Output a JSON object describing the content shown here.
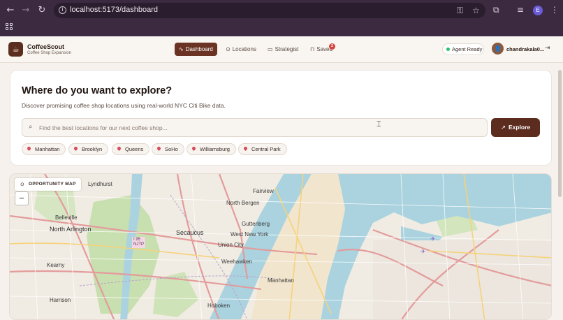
{
  "browser": {
    "url": "localhost:5173/dashboard",
    "profile_initial": "E"
  },
  "app": {
    "brand_title": "CoffeeScout",
    "brand_subtitle": "Coffee Shop Expansion",
    "nav": [
      {
        "label": "Dashboard",
        "icon": "activity-icon",
        "active": true
      },
      {
        "label": "Locations",
        "icon": "map-pin-icon",
        "active": false
      },
      {
        "label": "Strategist",
        "icon": "message-icon",
        "active": false
      },
      {
        "label": "Saved",
        "icon": "bookmark-icon",
        "active": false
      }
    ],
    "saved_count": "2",
    "agent_status": "Agent Ready",
    "user_name": "chandrakala0..."
  },
  "explore": {
    "heading": "Where do you want to explore?",
    "description": "Discover promising coffee shop locations using real-world NYC Citi Bike data.",
    "search_placeholder": "Find the best locations for our next coffee shop...",
    "search_value": "",
    "button_label": "Explore",
    "chips": [
      "Manhattan",
      "Brooklyn",
      "Queens",
      "SoHo",
      "Williamsburg",
      "Central Park"
    ]
  },
  "map": {
    "badge_label": "OPPORTUNITY MAP",
    "zoom_out_label": "−",
    "places": [
      {
        "name": "Lyndhurst"
      },
      {
        "name": "Fairview"
      },
      {
        "name": "North Bergen"
      },
      {
        "name": "Belleville"
      },
      {
        "name": "North Arlington"
      },
      {
        "name": "Secaucus"
      },
      {
        "name": "Guttenberg"
      },
      {
        "name": "West New York"
      },
      {
        "name": "Union City"
      },
      {
        "name": "Weehawken"
      },
      {
        "name": "Kearny"
      },
      {
        "name": "Harrison"
      },
      {
        "name": "Hoboken"
      },
      {
        "name": "Manhattan"
      }
    ],
    "highway_label": "I 95\nNJTP",
    "colors": {
      "water": "#aad3df",
      "park": "#c8dfb0",
      "land": "#f1ece3",
      "road": "#e8a6a6"
    }
  }
}
